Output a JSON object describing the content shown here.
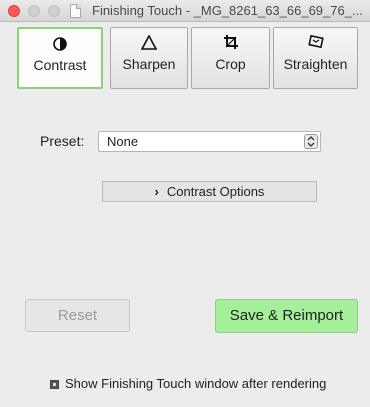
{
  "window": {
    "title": "Finishing Touch - _MG_8261_63_66_69_76_..."
  },
  "tabs": [
    {
      "label": "Contrast",
      "icon": "half-circle-icon",
      "active": true
    },
    {
      "label": "Sharpen",
      "icon": "triangle-icon",
      "active": false
    },
    {
      "label": "Crop",
      "icon": "crop-icon",
      "active": false
    },
    {
      "label": "Straighten",
      "icon": "rotate-square-icon",
      "active": false
    }
  ],
  "preset": {
    "label": "Preset:",
    "value": "None"
  },
  "contrast_options": {
    "label": "Contrast Options"
  },
  "buttons": {
    "reset": "Reset",
    "save_reimport": "Save & Reimport"
  },
  "show_window_checkbox": {
    "label": "Show Finishing Touch window after rendering",
    "checked": true
  },
  "colors": {
    "active_tab_border": "#8fd17a",
    "save_button": "#a4f09a",
    "close_button": "#fc5753"
  }
}
